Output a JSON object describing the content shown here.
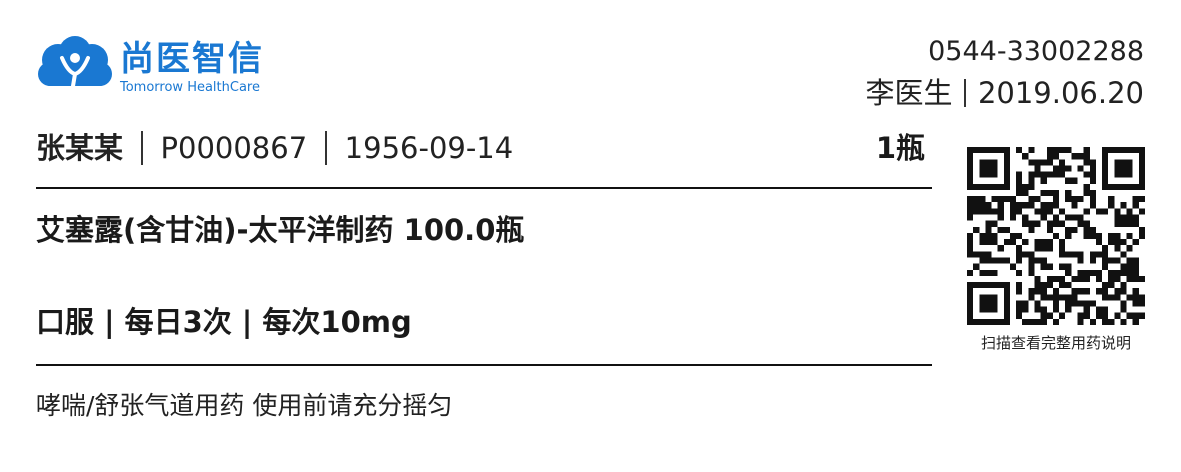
{
  "brand": {
    "name_cn": "尚医智信",
    "name_en": "Tomorrow HealthCare",
    "color": "#1a78d2"
  },
  "header": {
    "phone": "0544-33002288",
    "doctor": "李医生",
    "date": "2019.06.20"
  },
  "patient": {
    "name": "张某某",
    "id": "P0000867",
    "birthdate": "1956-09-14",
    "quantity": "1瓶"
  },
  "drug": {
    "description": "艾塞露(含甘油)-太平洋制药 100.0瓶"
  },
  "usage": {
    "route": "口服",
    "frequency": "每日3次",
    "dose": "每次10mg",
    "separator": "|"
  },
  "note": "哮喘/舒张气道用药 使用前请充分摇匀",
  "qr": {
    "caption": "扫描查看完整用药说明"
  }
}
